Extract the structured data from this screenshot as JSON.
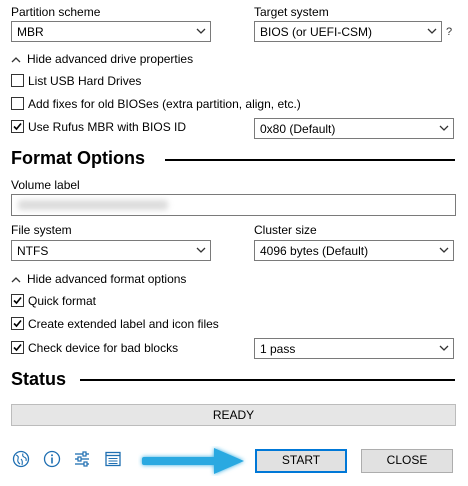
{
  "drive": {
    "partition_scheme_label": "Partition scheme",
    "partition_scheme_value": "MBR",
    "target_system_label": "Target system",
    "target_system_value": "BIOS (or UEFI-CSM)",
    "help_icon_text": "?",
    "advanced_toggle": "Hide advanced drive properties",
    "list_usb": {
      "label": "List USB Hard Drives",
      "checked": false
    },
    "fixes_old_bios": {
      "label": "Add fixes for old BIOSes (extra partition, align, etc.)",
      "checked": false
    },
    "rufus_mbr": {
      "label": "Use Rufus MBR with BIOS ID",
      "checked": true
    },
    "bios_id_value": "0x80 (Default)"
  },
  "format": {
    "section_title": "Format Options",
    "volume_label_label": "Volume label",
    "volume_label_value": "",
    "file_system_label": "File system",
    "file_system_value": "NTFS",
    "cluster_size_label": "Cluster size",
    "cluster_size_value": "4096 bytes (Default)",
    "advanced_toggle": "Hide advanced format options",
    "quick_format": {
      "label": "Quick format",
      "checked": true
    },
    "extended_label": {
      "label": "Create extended label and icon files",
      "checked": true
    },
    "bad_blocks": {
      "label": "Check device for bad blocks",
      "checked": true
    },
    "passes_value": "1 pass"
  },
  "status": {
    "section_title": "Status",
    "state_text": "READY"
  },
  "footer": {
    "start_label": "START",
    "close_label": "CLOSE",
    "icons": [
      "globe-icon",
      "info-icon",
      "settings-sliders-icon",
      "log-icon"
    ]
  },
  "colors": {
    "accent": "#0078d7",
    "arrow": "#29a9e1"
  }
}
